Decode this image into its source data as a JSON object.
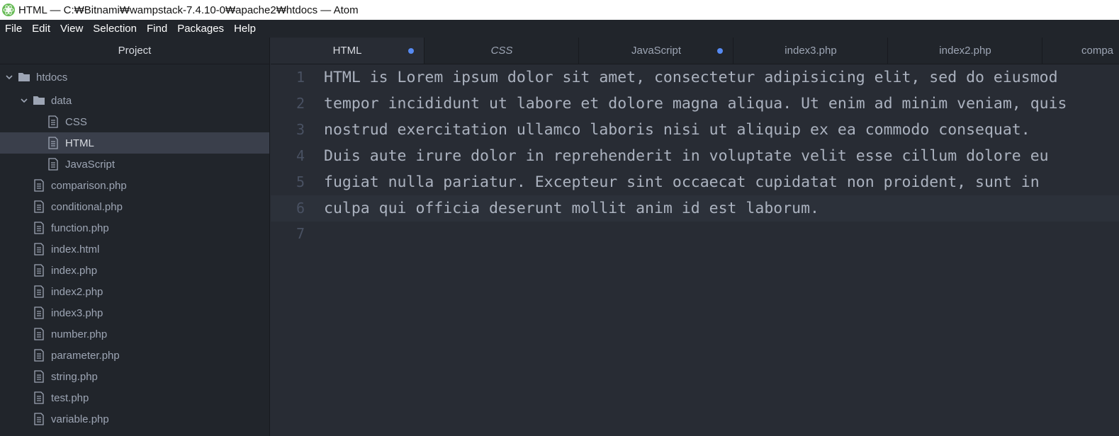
{
  "window": {
    "title": "HTML — C:₩Bitnami₩wampstack-7.4.10-0₩apache2₩htdocs — Atom",
    "icon": "atom-icon"
  },
  "menu": [
    "File",
    "Edit",
    "View",
    "Selection",
    "Find",
    "Packages",
    "Help"
  ],
  "tree": {
    "header": "Project",
    "items": [
      {
        "label": "htdocs",
        "type": "folder",
        "expanded": true,
        "depth": 0
      },
      {
        "label": "data",
        "type": "folder",
        "expanded": true,
        "depth": 1
      },
      {
        "label": "CSS",
        "type": "file",
        "depth": 2
      },
      {
        "label": "HTML",
        "type": "file",
        "depth": 2,
        "selected": true
      },
      {
        "label": "JavaScript",
        "type": "file",
        "depth": 2
      },
      {
        "label": "comparison.php",
        "type": "file",
        "depth": 1
      },
      {
        "label": "conditional.php",
        "type": "file",
        "depth": 1
      },
      {
        "label": "function.php",
        "type": "file",
        "depth": 1
      },
      {
        "label": "index.html",
        "type": "file",
        "depth": 1
      },
      {
        "label": "index.php",
        "type": "file",
        "depth": 1
      },
      {
        "label": "index2.php",
        "type": "file",
        "depth": 1
      },
      {
        "label": "index3.php",
        "type": "file",
        "depth": 1
      },
      {
        "label": "number.php",
        "type": "file",
        "depth": 1
      },
      {
        "label": "parameter.php",
        "type": "file",
        "depth": 1
      },
      {
        "label": "string.php",
        "type": "file",
        "depth": 1
      },
      {
        "label": "test.php",
        "type": "file",
        "depth": 1
      },
      {
        "label": "variable.php",
        "type": "file",
        "depth": 1
      }
    ]
  },
  "tabs": [
    {
      "label": "HTML",
      "active": true,
      "modified": true
    },
    {
      "label": "CSS",
      "italic": true
    },
    {
      "label": "JavaScript",
      "modified": true
    },
    {
      "label": "index3.php"
    },
    {
      "label": "index2.php"
    },
    {
      "label": "compa"
    }
  ],
  "editor": {
    "lines": [
      {
        "num": "1",
        "text": "HTML is Lorem ipsum dolor sit amet, consectetur adipisicing elit, sed do eiusmod"
      },
      {
        "num": "2",
        "text": "tempor incididunt ut labore et dolore magna aliqua. Ut enim ad minim veniam, quis"
      },
      {
        "num": "3",
        "text": "nostrud exercitation ullamco laboris nisi ut aliquip ex ea commodo consequat."
      },
      {
        "num": "4",
        "text": "Duis aute irure dolor in reprehenderit in voluptate velit esse cillum dolore eu"
      },
      {
        "num": "5",
        "text": "fugiat nulla pariatur. Excepteur sint occaecat cupidatat non proident, sunt in"
      },
      {
        "num": "6",
        "text": "culpa qui officia deserunt mollit anim id est laborum.",
        "cursor": true
      },
      {
        "num": "7",
        "text": ""
      }
    ]
  },
  "colors": {
    "modified_dot": "#568af2",
    "tree_bg": "#21252b",
    "editor_bg": "#282c34"
  }
}
